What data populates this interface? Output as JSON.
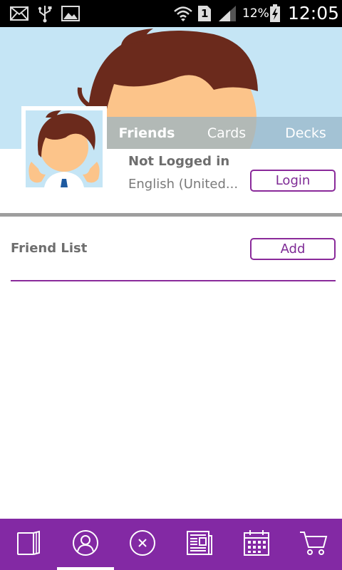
{
  "status_bar": {
    "icons": [
      "mail-icon",
      "usb-icon",
      "image-icon",
      "wifi-icon",
      "sim-1-icon",
      "signal-icon",
      "battery-charging-icon"
    ],
    "sim_label": "1",
    "battery": "12%",
    "time": "12:05"
  },
  "tabs": [
    {
      "label": "Friends",
      "active": true
    },
    {
      "label": "Cards",
      "active": false
    },
    {
      "label": "Decks",
      "active": false
    }
  ],
  "profile": {
    "name": "Not Logged in",
    "language": "English (United..."
  },
  "buttons": {
    "login": "Login",
    "add": "Add"
  },
  "friends": {
    "title": "Friend List",
    "items": []
  },
  "bottom_nav": {
    "items": [
      {
        "icon": "book-icon",
        "active": false
      },
      {
        "icon": "profile-icon",
        "active": true
      },
      {
        "icon": "close-circle-icon",
        "active": false
      },
      {
        "icon": "news-icon",
        "active": false
      },
      {
        "icon": "calendar-icon",
        "active": false
      },
      {
        "icon": "cart-icon",
        "active": false
      }
    ]
  },
  "colors": {
    "accent": "#8329a4",
    "header_bg": "#c5e5f5",
    "hair": "#6b2a1c",
    "skin": "#fcc48a"
  }
}
